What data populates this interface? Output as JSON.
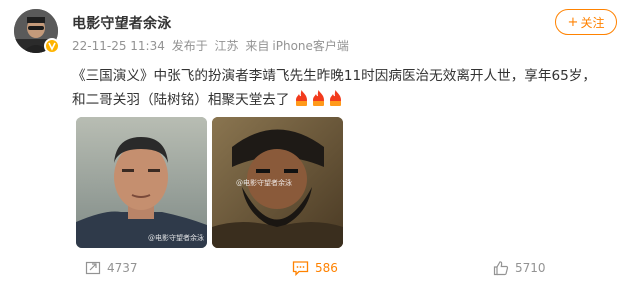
{
  "post": {
    "author": "电影守望者余泳",
    "timestamp": "22-11-25 11:34",
    "source_prefix": "发布于",
    "location": "江苏",
    "device_prefix": "来自",
    "device": "iPhone客户端",
    "follow_label": "关注",
    "text_line1": "《三国演义》中张飞的扮演者李靖飞先生昨晚11时因病医治无效离开人世，享年65岁，",
    "text_line2": "和二哥关羽（陆树铭）相聚天堂去了",
    "watermark1": "@电影守望者余泳",
    "watermark2": "@电影守望者余泳"
  },
  "footer": {
    "reposts": "4737",
    "comments": "586",
    "likes": "5710"
  },
  "colors": {
    "accent": "#ff8200",
    "meta_gray": "#939393",
    "verified_badge": "#ffb400"
  },
  "icons": [
    "verified-icon",
    "fire-icon",
    "repost-icon",
    "comment-icon",
    "like-icon"
  ]
}
